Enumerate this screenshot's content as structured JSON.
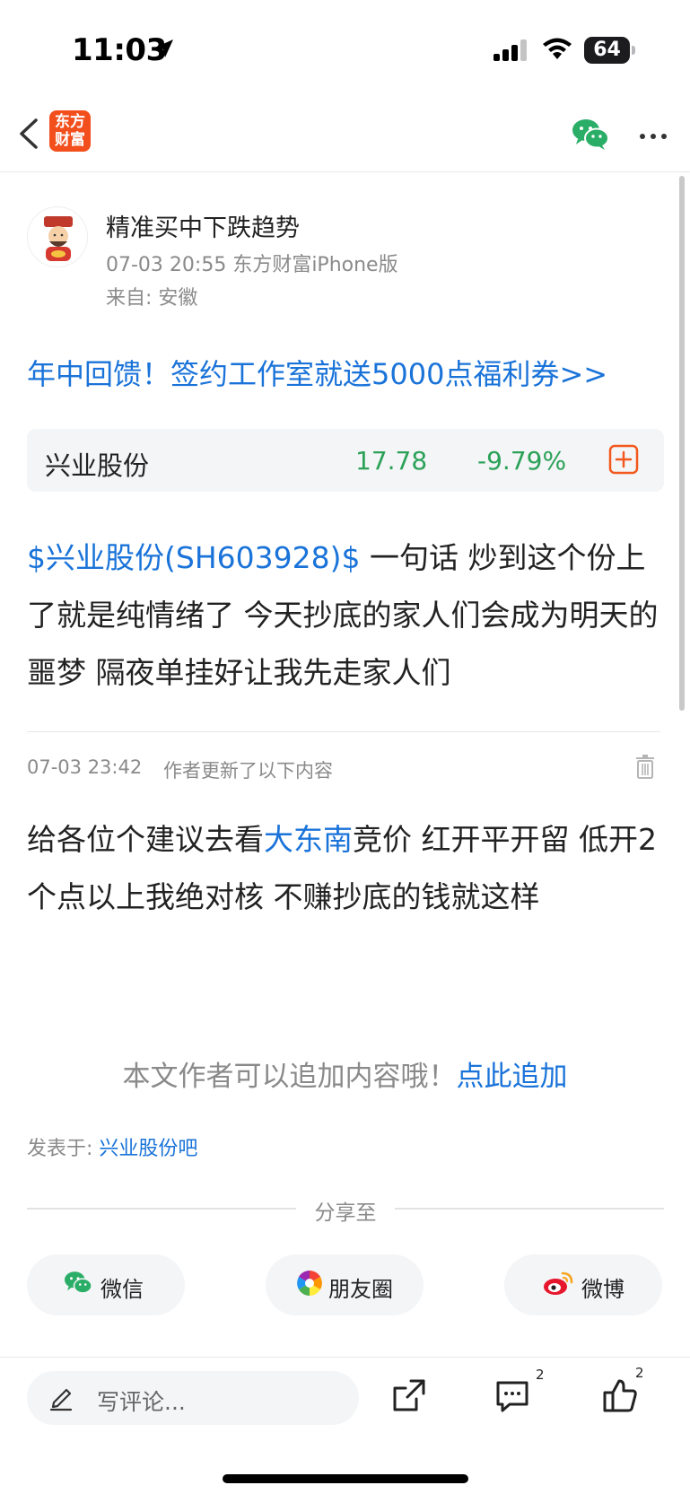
{
  "status_bar": {
    "time": "11:03",
    "battery": "64"
  },
  "nav": {
    "logo_line1": "东方",
    "logo_line2": "财富"
  },
  "author": {
    "name": "精准买中下跌趋势",
    "meta": "07-03 20:55 东方财富iPhone版",
    "from": "来自: 安徽"
  },
  "promo": "年中回馈！签约工作室就送5000点福利券>>",
  "stock": {
    "name": "兴业股份",
    "price": "17.78",
    "change": "-9.79%"
  },
  "post": {
    "cashtag": "$兴业股份(SH603928)$",
    "text": " 一句话 炒到这个份上了就是纯情绪了  今天抄底的家人们会成为明天的噩梦 隔夜单挂好让我先走家人们"
  },
  "update": {
    "time": "07-03 23:42",
    "note": "作者更新了以下内容",
    "text_before": "给各位个建议去看",
    "link": "大东南",
    "text_after": "竞价 红开平开留 低开2个点以上我绝对核 不赚抄底的钱就这样"
  },
  "append": {
    "hint": "本文作者可以追加内容哦！",
    "link": "点此追加"
  },
  "posted_in": {
    "label": "发表于: ",
    "board": "兴业股份吧"
  },
  "share": {
    "label": "分享至",
    "wechat": "微信",
    "moments": "朋友圈",
    "weibo": "微博"
  },
  "bottom_bar": {
    "comment_placeholder": "写评论...",
    "comment_count": "2",
    "like_count": "2"
  },
  "colors": {
    "link": "#1a73d9",
    "down": "#2ba158",
    "brand": "#f24f1c",
    "wechat": "#2aae67"
  }
}
